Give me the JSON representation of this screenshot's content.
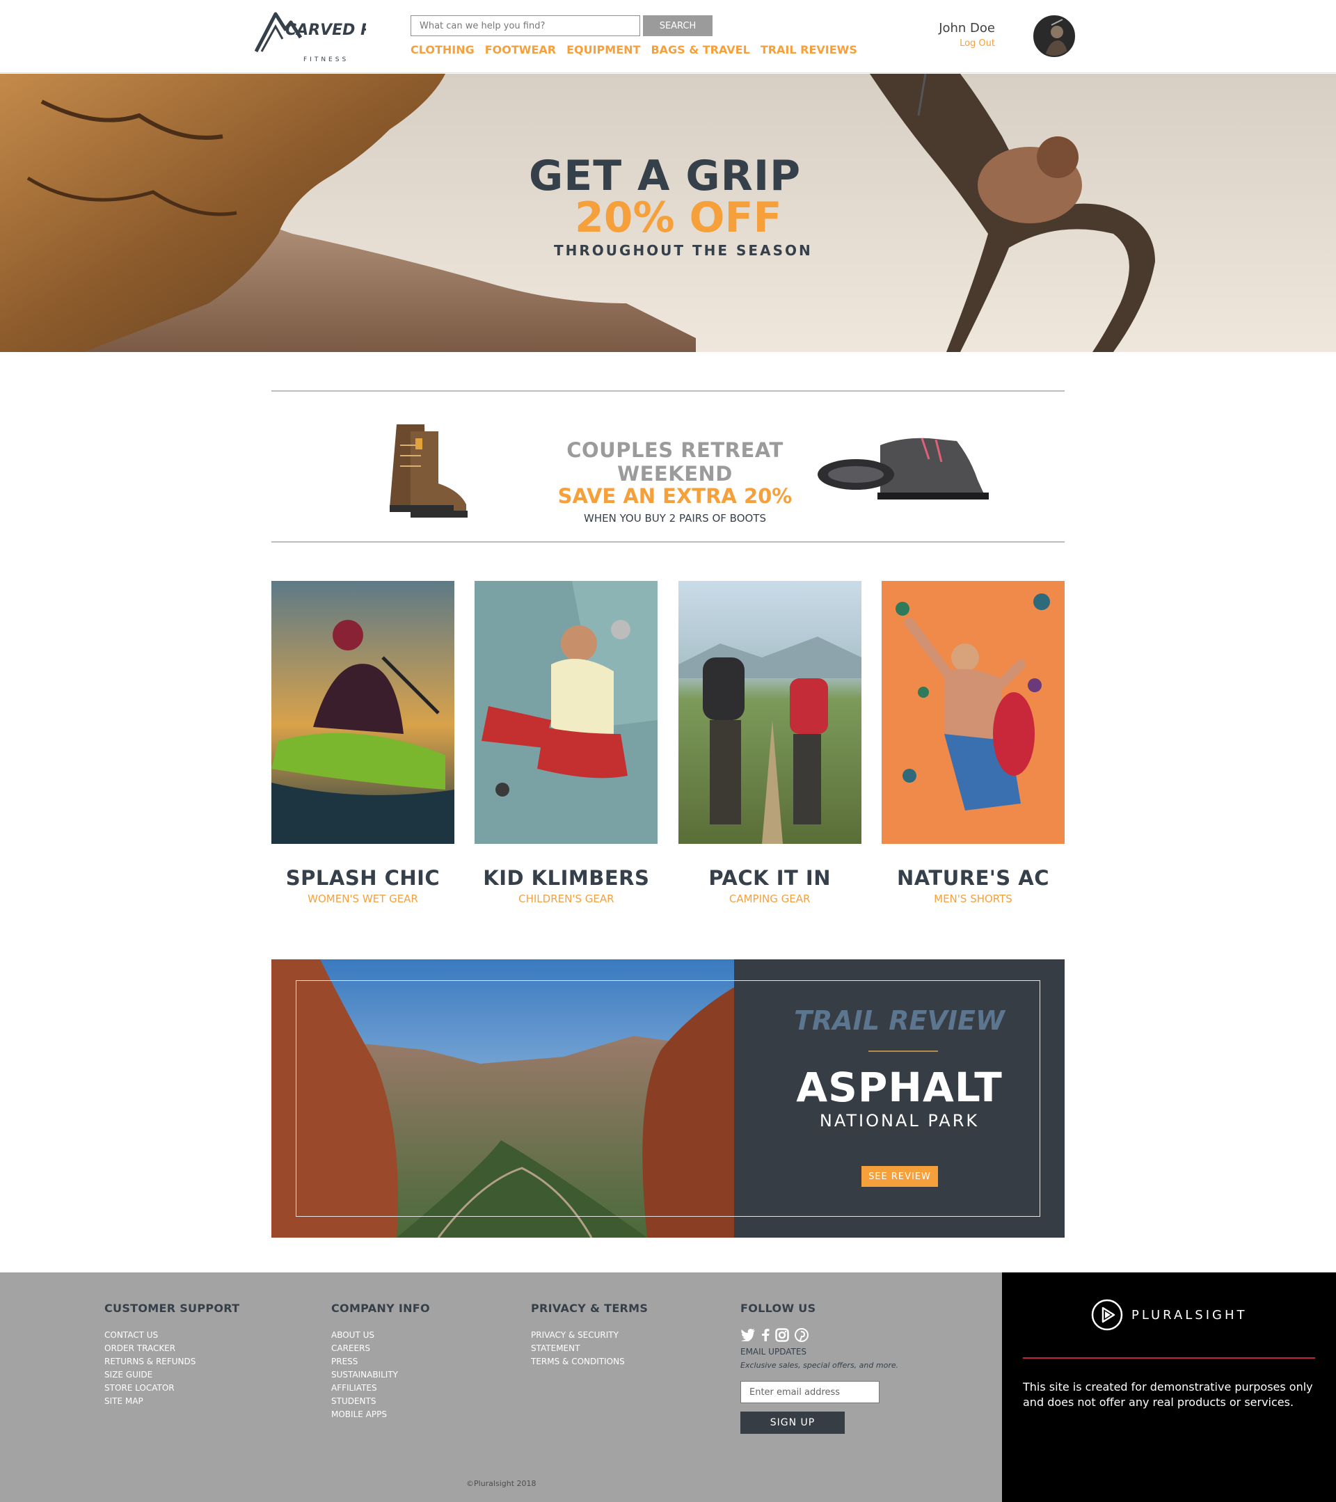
{
  "header": {
    "brand_name": "CARVED ROCK",
    "brand_tag": "FITNESS",
    "search": {
      "placeholder": "What can we help you find?",
      "button_label": "SEARCH"
    },
    "nav": [
      "CLOTHING",
      "FOOTWEAR",
      "EQUIPMENT",
      "BAGS & TRAVEL",
      "TRAIL REVIEWS"
    ],
    "user": {
      "name": "John Doe",
      "logout_label": "Log Out"
    }
  },
  "hero": {
    "title": "GET A GRIP",
    "discount": "20% OFF",
    "subtitle": "THROUGHOUT THE SEASON"
  },
  "promo": {
    "title": "COUPLES RETREAT WEEKEND",
    "offer": "SAVE AN EXTRA 20%",
    "note": "WHEN YOU BUY 2 PAIRS OF BOOTS"
  },
  "categories": [
    {
      "title": "SPLASH CHIC",
      "subtitle": "WOMEN'S WET GEAR"
    },
    {
      "title": "KID KLIMBERS",
      "subtitle": "CHILDREN'S GEAR"
    },
    {
      "title": "PACK IT IN",
      "subtitle": "CAMPING GEAR"
    },
    {
      "title": "NATURE'S AC",
      "subtitle": "MEN'S SHORTS"
    }
  ],
  "trail_review": {
    "kicker": "TRAIL REVIEW",
    "name": "ASPHALT",
    "subtitle": "NATIONAL PARK",
    "button_label": "SEE REVIEW"
  },
  "footer": {
    "customer_support": {
      "heading": "CUSTOMER SUPPORT",
      "links": [
        "CONTACT US",
        "ORDER TRACKER",
        "RETURNS & REFUNDS",
        "SIZE GUIDE",
        "STORE LOCATOR",
        "SITE MAP"
      ]
    },
    "company_info": {
      "heading": "COMPANY INFO",
      "links": [
        "ABOUT US",
        "CAREERS",
        "PRESS",
        "SUSTAINABILITY",
        "AFFILIATES",
        "STUDENTS",
        "MOBILE APPS"
      ]
    },
    "privacy_terms": {
      "heading": "PRIVACY & TERMS",
      "links": [
        "PRIVACY & SECURITY",
        "STATEMENT",
        "TERMS & CONDITIONS"
      ]
    },
    "follow_us": {
      "heading": "FOLLOW US",
      "social_icons": [
        "twitter-icon",
        "facebook-icon",
        "instagram-icon",
        "pinterest-icon"
      ],
      "email_label": "EMAIL UPDATES",
      "email_note": "Exclusive sales, special offers, and more.",
      "email_placeholder": "Enter email address",
      "signup_label": "SIGN UP"
    },
    "copyright": "©Pluralsight 2018"
  },
  "pluralsight": {
    "wordmark": "PLURALSIGHT",
    "disclaimer": "This site is created for demonstrative purposes only and does not offer any real products or services."
  },
  "colors": {
    "accent": "#f6a03c",
    "dark": "#36404a",
    "footer_bg": "#a3a3a3",
    "trail_panel": "#363d45",
    "brand_red": "#c0283b"
  }
}
